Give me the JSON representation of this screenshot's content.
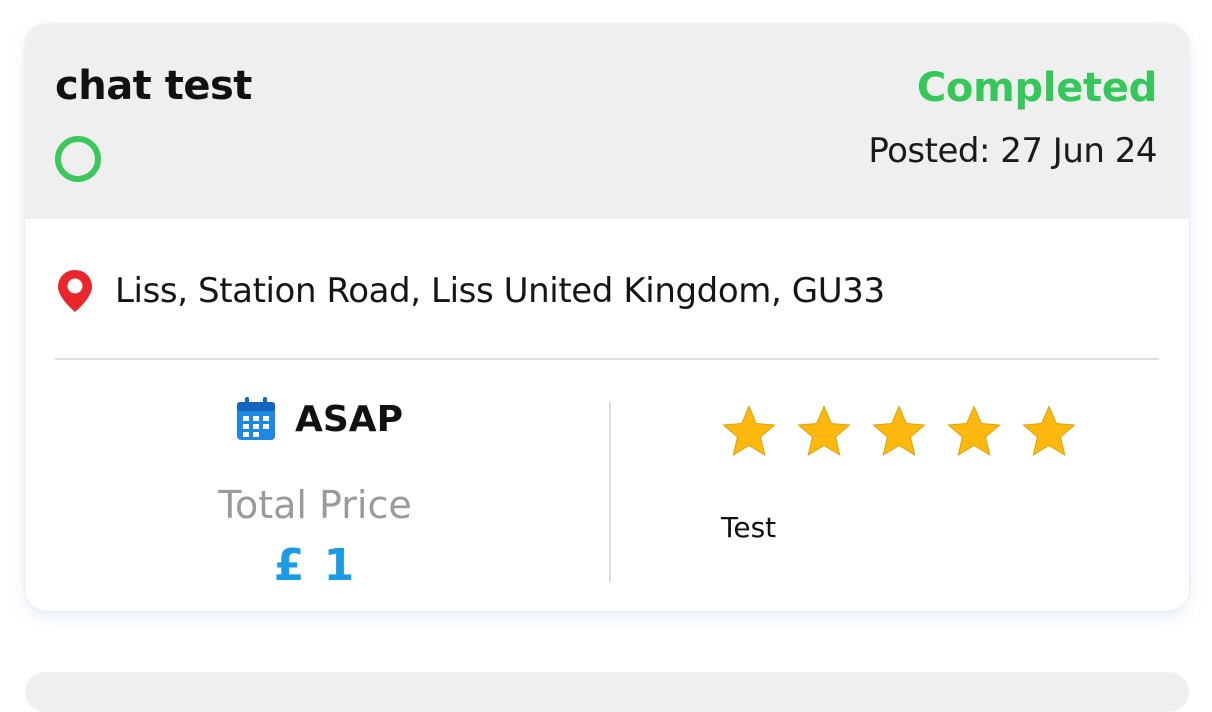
{
  "job": {
    "title": "chat test",
    "status": "Completed",
    "posted": "Posted: 27 Jun 24",
    "location": "Liss, Station Road, Liss United Kingdom, GU33",
    "when": "ASAP",
    "price_label": "Total Price",
    "price_value": "£ 1",
    "rating": 5,
    "rating_max": 5,
    "review": "Test"
  },
  "icons": {
    "status": "status-ring-icon",
    "location": "map-pin-icon",
    "date": "calendar-icon",
    "rating": "star-icon"
  },
  "colors": {
    "status_completed": "#34c759",
    "status_ring": "#3cc75a",
    "pin": "#e8262b",
    "calendar": "#1e88e5",
    "price": "#1a9be6",
    "star": "#ffb80e",
    "header_bg": "#efefef"
  }
}
